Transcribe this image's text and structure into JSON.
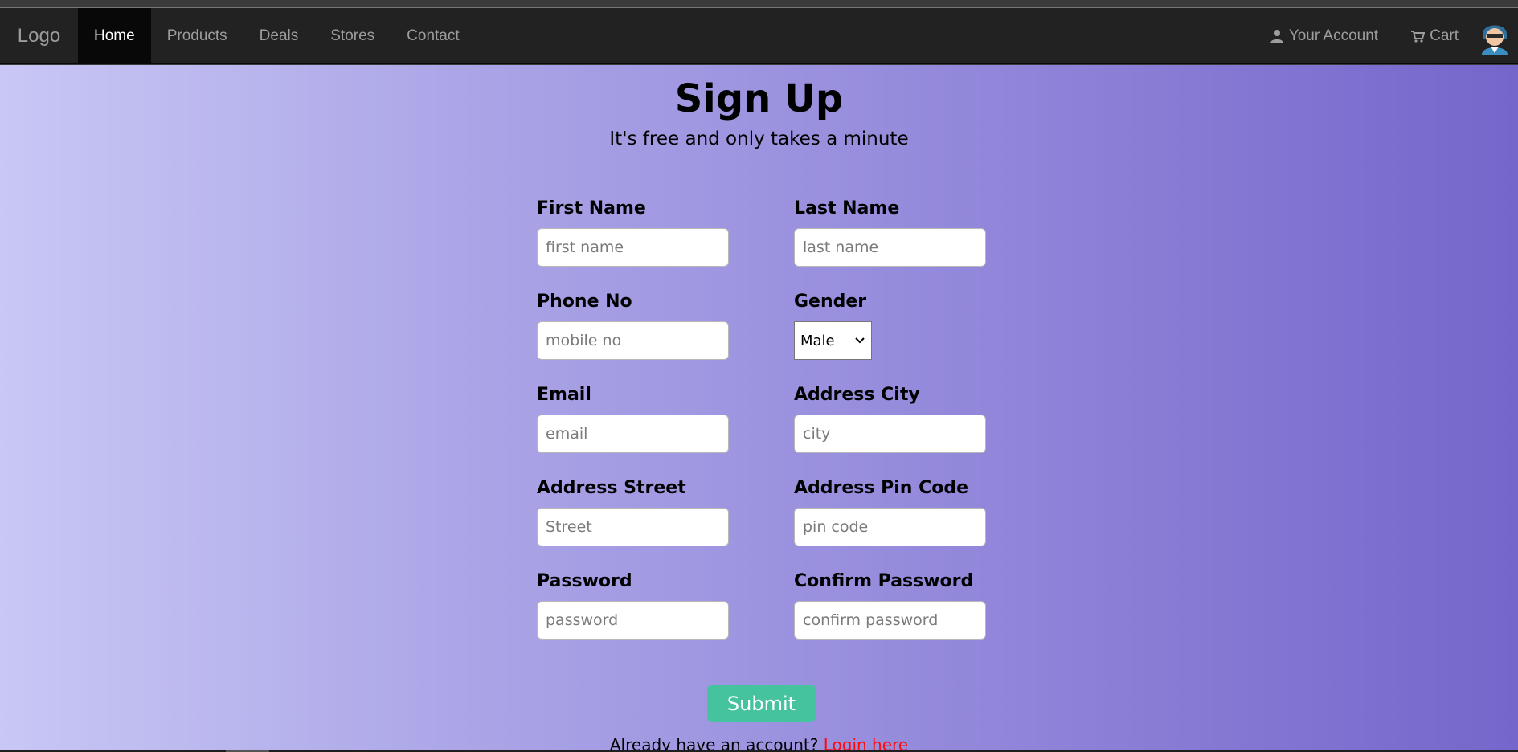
{
  "navbar": {
    "brand": "Logo",
    "links": [
      "Home",
      "Products",
      "Deals",
      "Stores",
      "Contact"
    ],
    "active": "Home",
    "account_label": "Your Account",
    "cart_label": "Cart"
  },
  "page": {
    "title": "Sign Up",
    "subtitle": "It's free and only takes a minute"
  },
  "form": {
    "first_name": {
      "label": "First Name",
      "placeholder": "first name"
    },
    "last_name": {
      "label": "Last Name",
      "placeholder": "last name"
    },
    "phone": {
      "label": "Phone No",
      "placeholder": "mobile no"
    },
    "gender": {
      "label": "Gender",
      "value": "Male"
    },
    "email": {
      "label": "Email",
      "placeholder": "email"
    },
    "city": {
      "label": "Address City",
      "placeholder": "city"
    },
    "street": {
      "label": "Address Street",
      "placeholder": "Street"
    },
    "pin": {
      "label": "Address Pin Code",
      "placeholder": "pin code"
    },
    "password": {
      "label": "Password",
      "placeholder": "password"
    },
    "confirm_password": {
      "label": "Confirm Password",
      "placeholder": "confirm password"
    },
    "submit_label": "Submit"
  },
  "footer": {
    "prompt": "Already have an account?",
    "login_link": "Login here"
  },
  "colors": {
    "navbar_bg": "#222222",
    "submit_bg": "#45c29e",
    "link_red": "#ff0a0a",
    "gradient_start": "#c8c7f5",
    "gradient_end": "#7566cb"
  },
  "icons": [
    "user-icon",
    "cart-icon",
    "avatar-icon",
    "chevron-down-icon"
  ]
}
